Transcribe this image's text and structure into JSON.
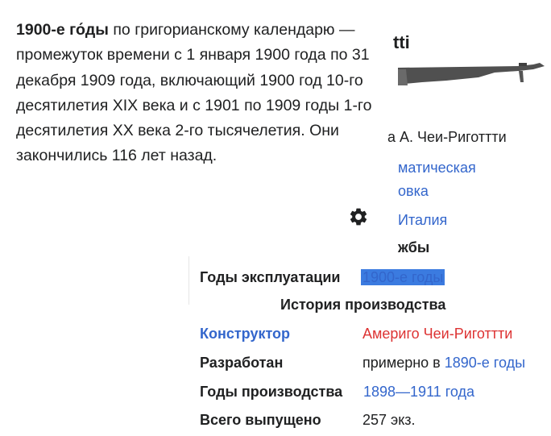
{
  "popup": {
    "term": "1900-е го́ды",
    "text": " по григорианскому календарю — промежуток времени с 1 января 1900 года по 31 декабря 1909 года, включающий 1900 год 10-го десятилетия XIX века и с 1901 по 1909 годы 1-го десятилетия XX века 2-го тысячелетия. Они закончились 116 лет назад.",
    "settings_icon": "gear-icon"
  },
  "infobox": {
    "title_fragment": "tti",
    "image_icon": "rifle-image",
    "caption_fragment": "а А. Чеи-Риготтти",
    "type_fragment_1": "матическая",
    "type_fragment_2": "овка",
    "country_fragment": "Италия",
    "service_fragment": "жбы",
    "rows": {
      "exploitation": {
        "label": "Годы эксплуатации",
        "value": "1900-е годы"
      },
      "section": "История производства",
      "designer": {
        "label": "Конструктор",
        "value": "Америго Чеи-Риготтти"
      },
      "developed": {
        "label": "Разработан",
        "prefix": "примерно в ",
        "value_link": "1890-е годы"
      },
      "production": {
        "label": "Годы производства",
        "value_link_1": "1898",
        "sep": "—",
        "value_link_2": "1911 года"
      },
      "total": {
        "label": "Всего выпущено",
        "value": "257 экз."
      }
    }
  }
}
